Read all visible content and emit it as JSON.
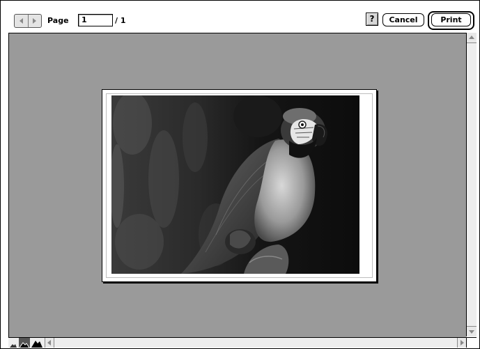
{
  "toolbar": {
    "nav_prev_icon": "triangle-left-icon",
    "nav_next_icon": "triangle-right-icon",
    "page_label": "Page",
    "page_value": "1",
    "page_total": "/ 1",
    "help_label": "?",
    "cancel_label": "Cancel",
    "print_label": "Print"
  },
  "preview": {
    "background_color": "#9a9a9a",
    "photo_subject": "macaw-parrot-photo"
  },
  "scrollbars": {
    "zoom_icons": [
      "mountain-small-icon",
      "mountain-medium-icon",
      "mountain-large-icon"
    ]
  }
}
